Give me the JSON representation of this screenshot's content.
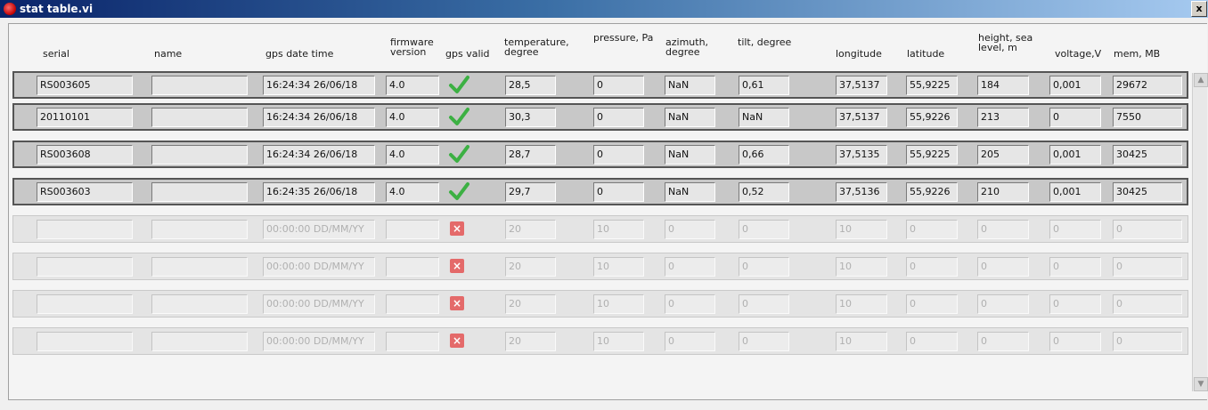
{
  "window": {
    "title": "stat table.vi",
    "close_label": "x",
    "icon": "labview-vi-icon"
  },
  "headers": [
    "serial",
    "name",
    "gps date time",
    "firmware version",
    "gps valid",
    "temperature, degree",
    "pressure, Pa",
    "azimuth, degree",
    "tilt, degree",
    "longitude",
    "latitude",
    "height, sea level, m",
    "voltage,V",
    "mem, MB"
  ],
  "rows": [
    {
      "serial": "RS003605",
      "name": "",
      "gps_date_time": "16:24:34 26/06/18",
      "firmware": "4.0",
      "gps_valid": true,
      "temperature": "28,5",
      "pressure": "0",
      "azimuth": "NaN",
      "tilt": "0,61",
      "longitude": "37,5137",
      "latitude": "55,9225",
      "height": "184",
      "voltage": "0,001",
      "mem": "29672"
    },
    {
      "serial": "20110101",
      "name": "",
      "gps_date_time": "16:24:34 26/06/18",
      "firmware": "4.0",
      "gps_valid": true,
      "temperature": "30,3",
      "pressure": "0",
      "azimuth": "NaN",
      "tilt": "NaN",
      "longitude": "37,5137",
      "latitude": "55,9226",
      "height": "213",
      "voltage": "0",
      "mem": "7550"
    },
    {
      "serial": "RS003608",
      "name": "",
      "gps_date_time": "16:24:34 26/06/18",
      "firmware": "4.0",
      "gps_valid": true,
      "temperature": "28,7",
      "pressure": "0",
      "azimuth": "NaN",
      "tilt": "0,66",
      "longitude": "37,5135",
      "latitude": "55,9225",
      "height": "205",
      "voltage": "0,001",
      "mem": "30425"
    },
    {
      "serial": "RS003603",
      "name": "",
      "gps_date_time": "16:24:35 26/06/18",
      "firmware": "4.0",
      "gps_valid": true,
      "temperature": "29,7",
      "pressure": "0",
      "azimuth": "NaN",
      "tilt": "0,52",
      "longitude": "37,5136",
      "latitude": "55,9226",
      "height": "210",
      "voltage": "0,001",
      "mem": "30425"
    },
    {
      "serial": "",
      "name": "",
      "gps_date_time": "00:00:00 DD/MM/YY",
      "firmware": "",
      "gps_valid": false,
      "temperature": "20",
      "pressure": "10",
      "azimuth": "0",
      "tilt": "0",
      "longitude": "10",
      "latitude": "0",
      "height": "0",
      "voltage": "0",
      "mem": "0"
    },
    {
      "serial": "",
      "name": "",
      "gps_date_time": "00:00:00 DD/MM/YY",
      "firmware": "",
      "gps_valid": false,
      "temperature": "20",
      "pressure": "10",
      "azimuth": "0",
      "tilt": "0",
      "longitude": "10",
      "latitude": "0",
      "height": "0",
      "voltage": "0",
      "mem": "0"
    },
    {
      "serial": "",
      "name": "",
      "gps_date_time": "00:00:00 DD/MM/YY",
      "firmware": "",
      "gps_valid": false,
      "temperature": "20",
      "pressure": "10",
      "azimuth": "0",
      "tilt": "0",
      "longitude": "10",
      "latitude": "0",
      "height": "0",
      "voltage": "0",
      "mem": "0"
    },
    {
      "serial": "",
      "name": "",
      "gps_date_time": "00:00:00 DD/MM/YY",
      "firmware": "",
      "gps_valid": false,
      "temperature": "20",
      "pressure": "10",
      "azimuth": "0",
      "tilt": "0",
      "longitude": "10",
      "latitude": "0",
      "height": "0",
      "voltage": "0",
      "mem": "0"
    }
  ],
  "scrollbar": {
    "up_icon": "scroll-up-arrow-icon",
    "down_icon": "scroll-down-arrow-icon"
  },
  "colors": {
    "valid": "#3cb043",
    "invalid": "#e46a6a",
    "titlebar_start": "#0a246a"
  }
}
